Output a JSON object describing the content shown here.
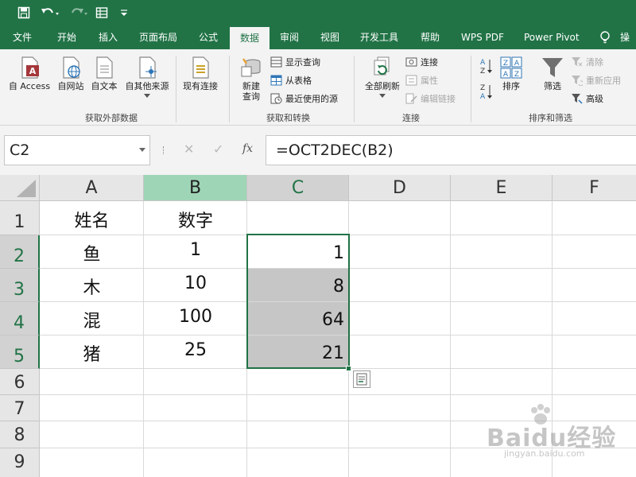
{
  "quick_access": {
    "save_icon": "save-icon",
    "undo_icon": "undo-icon",
    "redo_icon": "redo-icon",
    "form_icon": "form-icon",
    "customize_icon": "customize-dropdown-icon"
  },
  "tabs": [
    {
      "label": "文件"
    },
    {
      "label": "开始"
    },
    {
      "label": "插入"
    },
    {
      "label": "页面布局"
    },
    {
      "label": "公式"
    },
    {
      "label": "数据"
    },
    {
      "label": "审阅"
    },
    {
      "label": "视图"
    },
    {
      "label": "开发工具"
    },
    {
      "label": "帮助"
    },
    {
      "label": "WPS PDF"
    },
    {
      "label": "Power Pivot"
    },
    {
      "label": "操"
    }
  ],
  "active_tab": "数据",
  "ribbon": {
    "get_external": {
      "group_label": "获取外部数据",
      "buttons": [
        "自 Access",
        "自网站",
        "自文本",
        "自其他来源",
        "现有连接"
      ]
    },
    "get_transform": {
      "group_label": "获取和转换",
      "new_query_line1": "新建",
      "new_query_line2": "查询",
      "small": [
        "显示查询",
        "从表格",
        "最近使用的源"
      ]
    },
    "connections": {
      "group_label": "连接",
      "refresh_all": "全部刷新",
      "small": [
        "连接",
        "属性",
        "编辑链接"
      ]
    },
    "sort_filter": {
      "group_label": "排序和筛选",
      "sort": "排序",
      "filter": "筛选",
      "small": [
        "清除",
        "重新应用",
        "高级"
      ]
    }
  },
  "formula_bar": {
    "name_box": "C2",
    "formula": "=OCT2DEC(B2)",
    "fx_label": "fx"
  },
  "grid": {
    "columns": [
      "A",
      "B",
      "C",
      "D",
      "E",
      "F"
    ],
    "rows": [
      "1",
      "2",
      "3",
      "4",
      "5",
      "6",
      "7",
      "8",
      "9"
    ],
    "cells": {
      "A1": "姓名",
      "B1": "数字",
      "A2": "鱼",
      "B2": "1",
      "C2": "1",
      "A3": "木",
      "B3": "10",
      "C3": "8",
      "A4": "混",
      "B4": "100",
      "C4": "64",
      "A5": "猪",
      "B5": "25",
      "C5": "21"
    },
    "selected_range": "C2:C5",
    "active_cell": "C2"
  },
  "watermark": {
    "main": "Baidu经验",
    "sub": "jingyan.baidu.com"
  },
  "colors": {
    "brand": "#217346",
    "ref_column": "#9fd5b7",
    "selection": "#c6c6c6"
  }
}
